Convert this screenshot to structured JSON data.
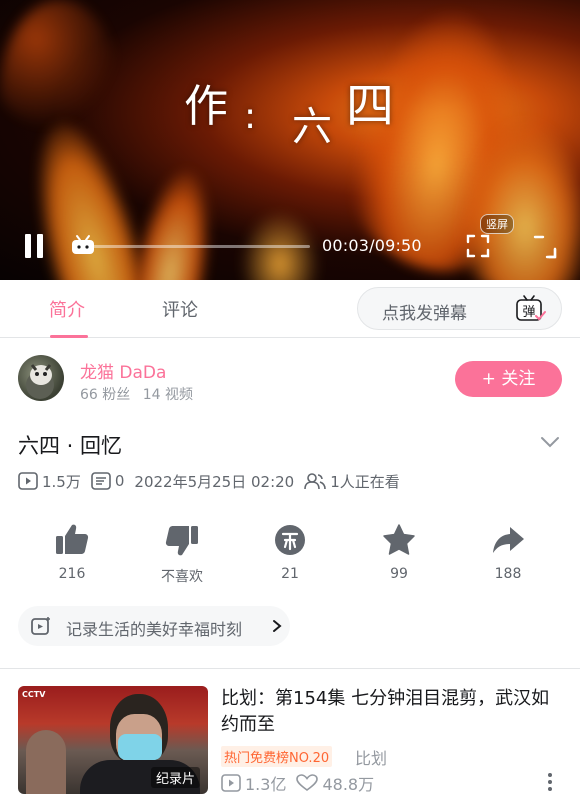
{
  "player": {
    "overlay_text": [
      "作",
      ":",
      "六",
      "四"
    ],
    "current_time": "00:03",
    "duration": "09:50",
    "time_display": "00:03/09:50",
    "progress_fraction": 0.005,
    "portrait_label": "竖屏"
  },
  "tabs": [
    {
      "label": "简介",
      "active": true
    },
    {
      "label": "评论",
      "active": false
    }
  ],
  "danmaku": {
    "placeholder": "点我发弹幕",
    "icon_glyph": "弹"
  },
  "uploader": {
    "name": "龙猫 DaDa",
    "fans": "66 粉丝",
    "videos": "14 视频",
    "follow_label": "+ 关注"
  },
  "video": {
    "title": "六四 · 回忆",
    "views": "1.5万",
    "danmaku_count": "0",
    "date": "2022年5月25日 02:20",
    "watching": "1人正在看"
  },
  "actions": [
    {
      "name": "like",
      "icon": "thumb-up-icon",
      "label": "216"
    },
    {
      "name": "dislike",
      "icon": "thumb-down-icon",
      "label": "不喜欢"
    },
    {
      "name": "coin",
      "icon": "coin-icon",
      "label": "21"
    },
    {
      "name": "favorite",
      "icon": "star-icon",
      "label": "99"
    },
    {
      "name": "share",
      "icon": "share-icon",
      "label": "188"
    }
  ],
  "tag": {
    "text": "记录生活的美好幸福时刻"
  },
  "recommendation": {
    "title": "比划：第154集 七分钟泪目混剪，武汉如约而至",
    "rank_badge": "热门免费榜NO.20",
    "uploader": "比划",
    "views": "1.3亿",
    "likes": "48.8万",
    "thumb_badge": "纪录片",
    "thumb_logo": "CCTV"
  },
  "colors": {
    "accent": "#fb7299",
    "text_secondary": "#61666d",
    "text_muted": "#9499a0",
    "rank": "#ff6633"
  }
}
